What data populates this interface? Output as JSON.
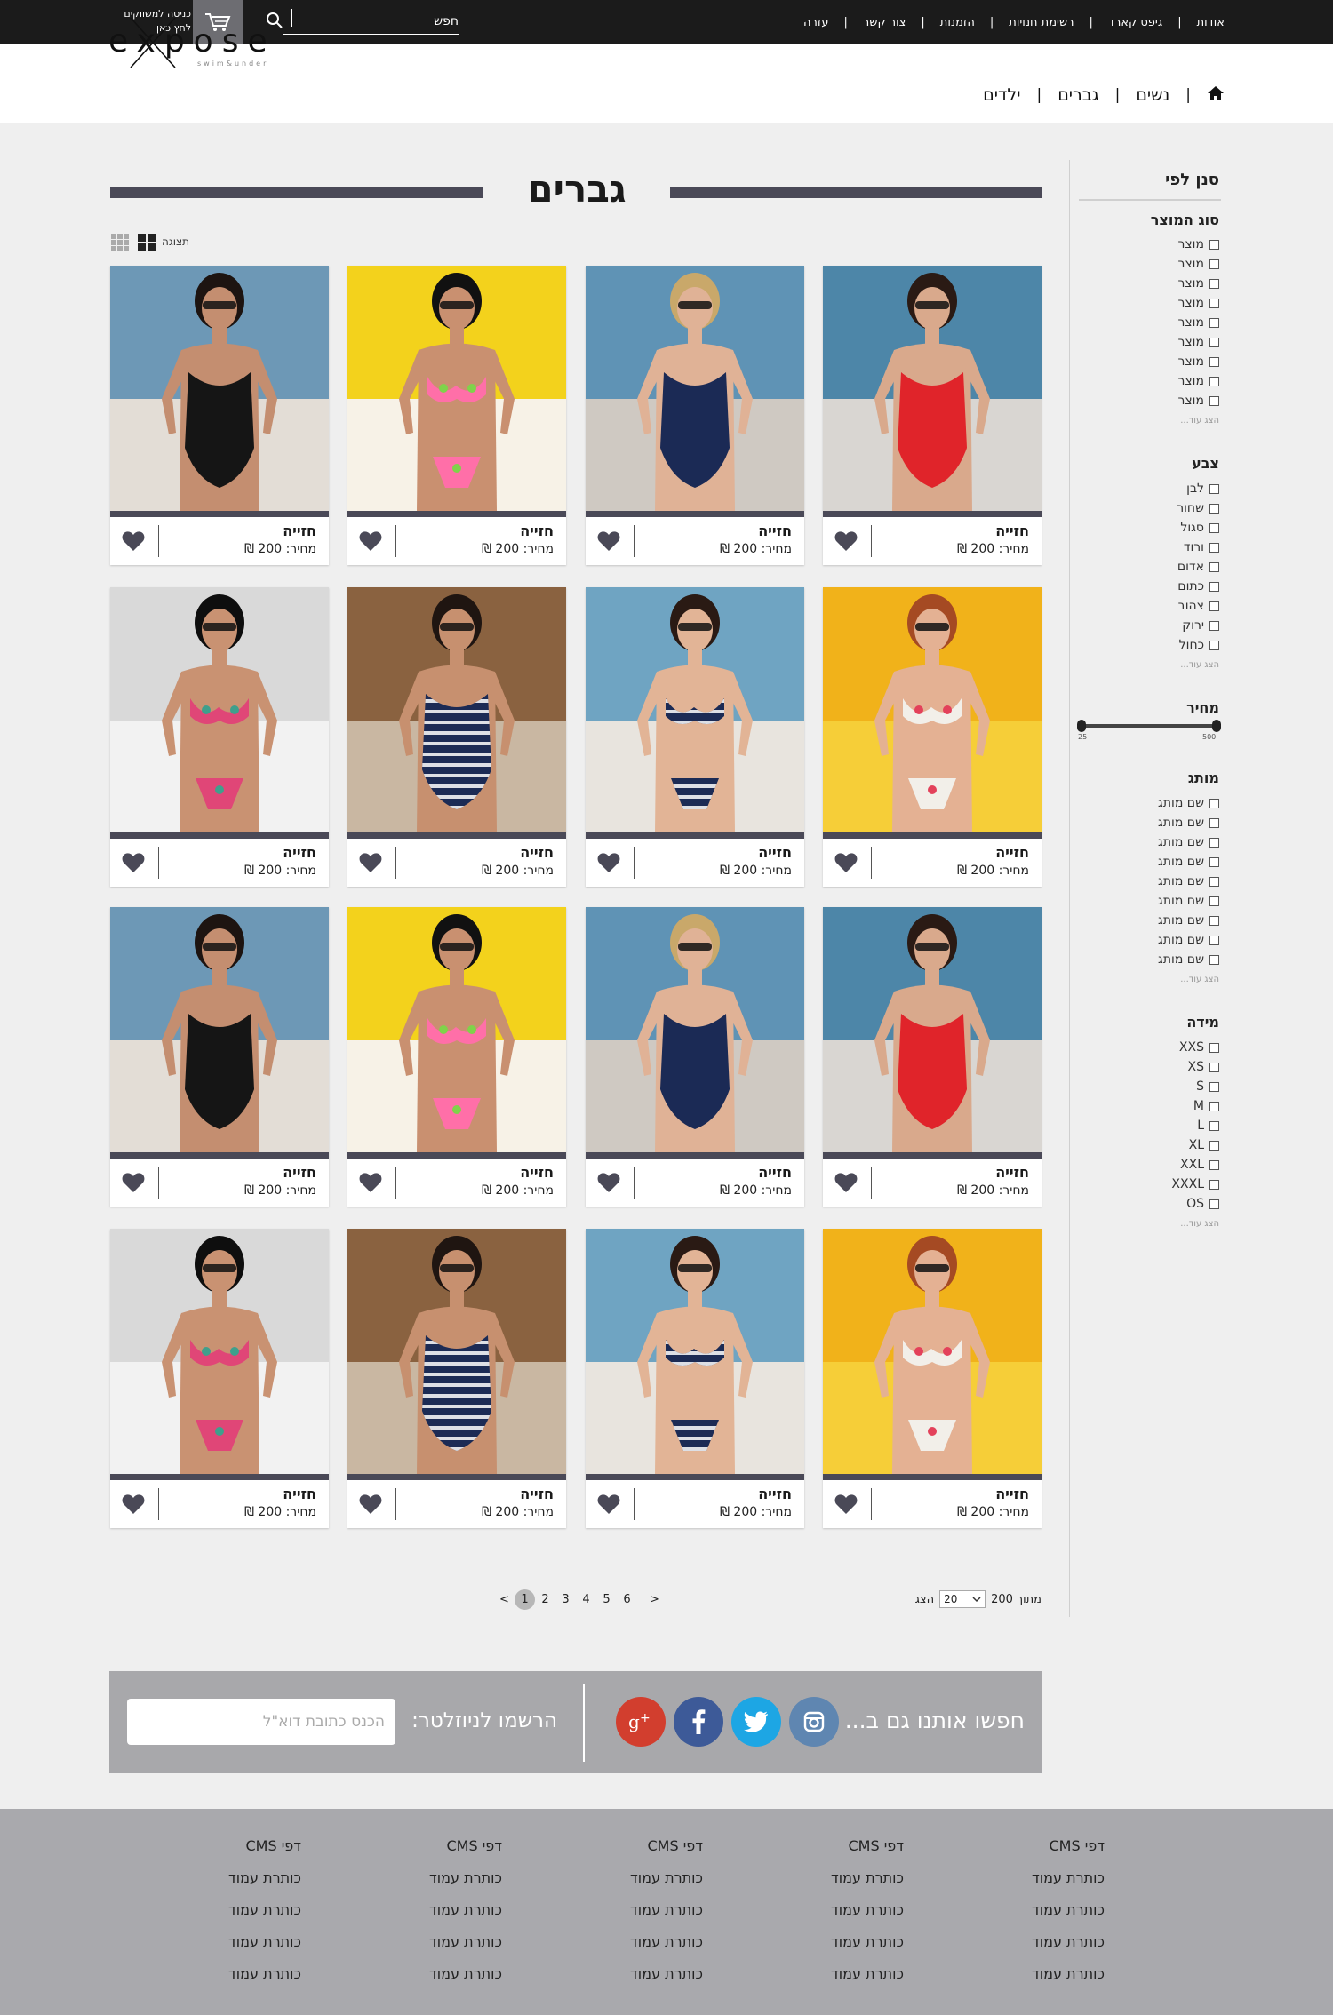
{
  "topbar": {
    "nav": [
      "אודות",
      "גיפט קארד",
      "רשימת חנויות",
      "הזמנות",
      "צור קשר",
      "עזרה"
    ],
    "search_placeholder": "חפש",
    "dealer_line1": "כניסה למשווקים",
    "dealer_line2": "לחץ כאן"
  },
  "logo": {
    "main": "expose",
    "sub": "swim&under"
  },
  "mainnav": {
    "items": [
      "נשים",
      "גברים",
      "ילדים"
    ]
  },
  "category_title": "גברים",
  "view": {
    "label": "תצוגה"
  },
  "filters": {
    "title": "סנן לפי",
    "show_more": "הצג עוד...",
    "product_type": {
      "title": "סוג המוצר",
      "options": [
        "מוצר",
        "מוצר",
        "מוצר",
        "מוצר",
        "מוצר",
        "מוצר",
        "מוצר",
        "מוצר",
        "מוצר"
      ]
    },
    "color": {
      "title": "צבע",
      "options": [
        "לבן",
        "שחור",
        "סגול",
        "ורוד",
        "אדום",
        "כתום",
        "צהוב",
        "ירוק",
        "כחול"
      ]
    },
    "price": {
      "title": "מחיר",
      "min": "25",
      "max": "500"
    },
    "brand": {
      "title": "מותג",
      "options": [
        "שם מותג",
        "שם מותג",
        "שם מותג",
        "שם מותג",
        "שם מותג",
        "שם מותג",
        "שם מותג",
        "שם מותג",
        "שם מותג"
      ]
    },
    "size": {
      "title": "מידה",
      "options": [
        "XXS",
        "XS",
        "S",
        "M",
        "L",
        "XL",
        "XXL",
        "XXXL",
        "OS"
      ]
    }
  },
  "products": {
    "name": "חזייה",
    "price": "מחיר: 200 ₪",
    "items": [
      {
        "model": "red"
      },
      {
        "model": "navy"
      },
      {
        "model": "yellow"
      },
      {
        "model": "black"
      },
      {
        "model": "floral"
      },
      {
        "model": "stripe"
      },
      {
        "model": "brown"
      },
      {
        "model": "white"
      },
      {
        "model": "red"
      },
      {
        "model": "navy"
      },
      {
        "model": "yellow"
      },
      {
        "model": "black"
      },
      {
        "model": "floral"
      },
      {
        "model": "stripe"
      },
      {
        "model": "brown"
      },
      {
        "model": "white"
      }
    ]
  },
  "pagination": {
    "prev": "<",
    "pages": [
      "1",
      "2",
      "3",
      "4",
      "5",
      "6"
    ],
    "current": "1",
    "next": ">",
    "show_label": "הצג",
    "per_page": "20",
    "of_total": "מתוך 200"
  },
  "social": {
    "follow_text": "חפשו אותנו גם ב...",
    "networks": [
      "instagram-icon",
      "twitter-icon",
      "facebook-icon",
      "google-plus-icon"
    ],
    "colors": {
      "instagram": "#5f86b1",
      "twitter": "#1da6e4",
      "facebook": "#3d5a98",
      "google_plus": "#d23e2e"
    }
  },
  "newsletter": {
    "label": "הרשמו לניוזלטר:",
    "placeholder": "הכנס כתובת דוא\"ל"
  },
  "footer": {
    "columns": [
      {
        "title": "דפי CMS",
        "links": [
          "כותרת עמוד",
          "כותרת עמוד",
          "כותרת עמוד",
          "כותרת עמוד"
        ]
      },
      {
        "title": "דפי CMS",
        "links": [
          "כותרת עמוד",
          "כותרת עמוד",
          "כותרת עמוד",
          "כותרת עמוד"
        ]
      },
      {
        "title": "דפי CMS",
        "links": [
          "כותרת עמוד",
          "כותרת עמוד",
          "כותרת עמוד",
          "כותרת עמוד"
        ]
      },
      {
        "title": "דפי CMS",
        "links": [
          "כותרת עמוד",
          "כותרת עמוד",
          "כותרת עמוד",
          "כותרת עמוד"
        ]
      },
      {
        "title": "דפי CMS",
        "links": [
          "כותרת עמוד",
          "כותרת עמוד",
          "כותרת עמוד",
          "כותרת עמוד"
        ]
      }
    ]
  }
}
